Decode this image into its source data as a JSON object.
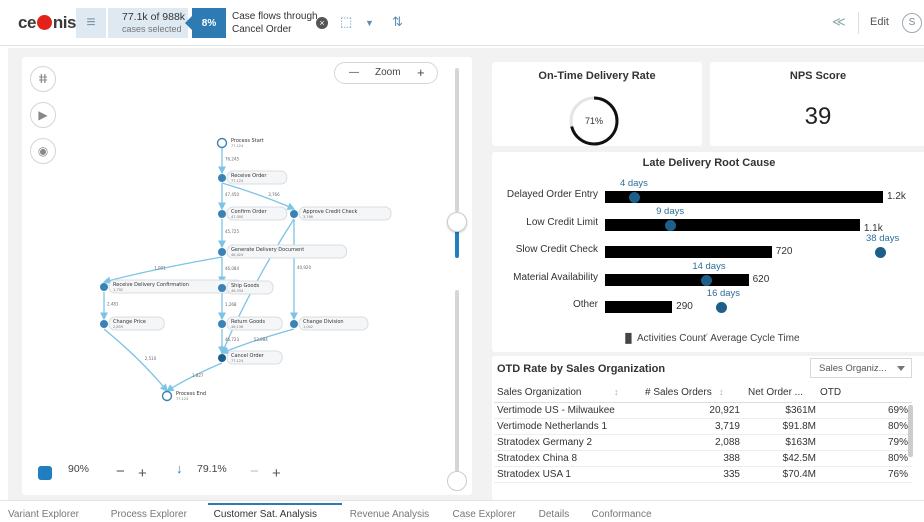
{
  "header": {
    "logo_text": "celonis",
    "selection": {
      "count": "77.1k of 988k",
      "label": "cases selected"
    },
    "selection_pct": "8%",
    "filter": {
      "line1": "Case flows through",
      "line2": "Cancel Order"
    },
    "edit_label": "Edit",
    "avatar_initial": "S"
  },
  "process_explorer": {
    "zoom_label": "Zoom",
    "activity_pct": "90%",
    "connection_pct": "79.1%",
    "nodes": [
      {
        "name": "Process Start",
        "count": "77,124"
      },
      {
        "name": "Receive Order",
        "count": "77,124"
      },
      {
        "name": "Confirm Order",
        "count": "47,000"
      },
      {
        "name": "Approve Credit Check",
        "count": "3,766"
      },
      {
        "name": "Generate Delivery Document",
        "count": "46,424"
      },
      {
        "name": "Receive Delivery Confirmation",
        "count": "1,792"
      },
      {
        "name": "Ship Goods",
        "count": "46,334"
      },
      {
        "name": "Change Price",
        "count": "2,859"
      },
      {
        "name": "Return Goods",
        "count": "46,136"
      },
      {
        "name": "Change Division",
        "count": "1,002"
      },
      {
        "name": "Cancel Order",
        "count": "77,124"
      },
      {
        "name": "Process End",
        "count": "77,124"
      }
    ],
    "edge_labels": [
      "76,245",
      "47,450",
      "3,766",
      "45,725",
      "1,001",
      "46,084",
      "40,920",
      "325",
      "2,481",
      "1,268",
      "46,723",
      "2,510",
      "1,827",
      "53,884"
    ]
  },
  "kpi_ontime": {
    "title": "On-Time Delivery Rate",
    "value": "71%",
    "fraction": 0.71
  },
  "kpi_nps": {
    "title": "NPS Score",
    "value": "39"
  },
  "chart_data": {
    "type": "bar",
    "title": "Late Delivery Root Cause",
    "categories": [
      "Delayed Order Entry",
      "Low Credit Limit",
      "Slow Credit Check",
      "Material Availability",
      "Other"
    ],
    "series": [
      {
        "name": "Activities Count",
        "values": [
          1200,
          1100,
          720,
          620,
          290
        ],
        "labels": [
          "1.2k",
          "1.1k",
          "720",
          "620",
          "290"
        ]
      },
      {
        "name": "Average Cycle Time",
        "values": [
          4,
          9,
          38,
          14,
          16
        ],
        "labels": [
          "4 days",
          "9 days",
          "38 days",
          "14 days",
          "16 days"
        ]
      }
    ],
    "legend_position": "bottom",
    "colors": {
      "count": "#000000",
      "cycle": "#1e5f8a"
    }
  },
  "otd_table": {
    "title": "OTD Rate by Sales Organization",
    "dropdown": "Sales Organiz...",
    "columns": [
      "Sales Organization",
      "# Sales Orders",
      "Net Order ...",
      "OTD"
    ],
    "rows": [
      [
        "Vertimode US - Milwaukee",
        "20,921",
        "$361M",
        "69%"
      ],
      [
        "Vertimode Netherlands 1",
        "3,719",
        "$91.8M",
        "80%"
      ],
      [
        "Stratodex Germany 2",
        "2,088",
        "$163M",
        "79%"
      ],
      [
        "Stratodex China 8",
        "388",
        "$42.5M",
        "80%"
      ],
      [
        "Stratodex USA 1",
        "335",
        "$70.4M",
        "76%"
      ]
    ]
  },
  "tabs": [
    {
      "label": "Variant Explorer",
      "active": false
    },
    {
      "label": "Process Explorer",
      "active": false
    },
    {
      "label": "Customer Sat. Analysis",
      "active": true
    },
    {
      "label": "Revenue Analysis",
      "active": false
    },
    {
      "label": "Case Explorer",
      "active": false
    },
    {
      "label": "Details",
      "active": false
    },
    {
      "label": "Conformance",
      "active": false
    }
  ],
  "colors": {
    "accent": "#2e7bb3",
    "brand_red": "#e2231a",
    "node": "#1e5f8a",
    "edge": "#7cc3e6"
  }
}
